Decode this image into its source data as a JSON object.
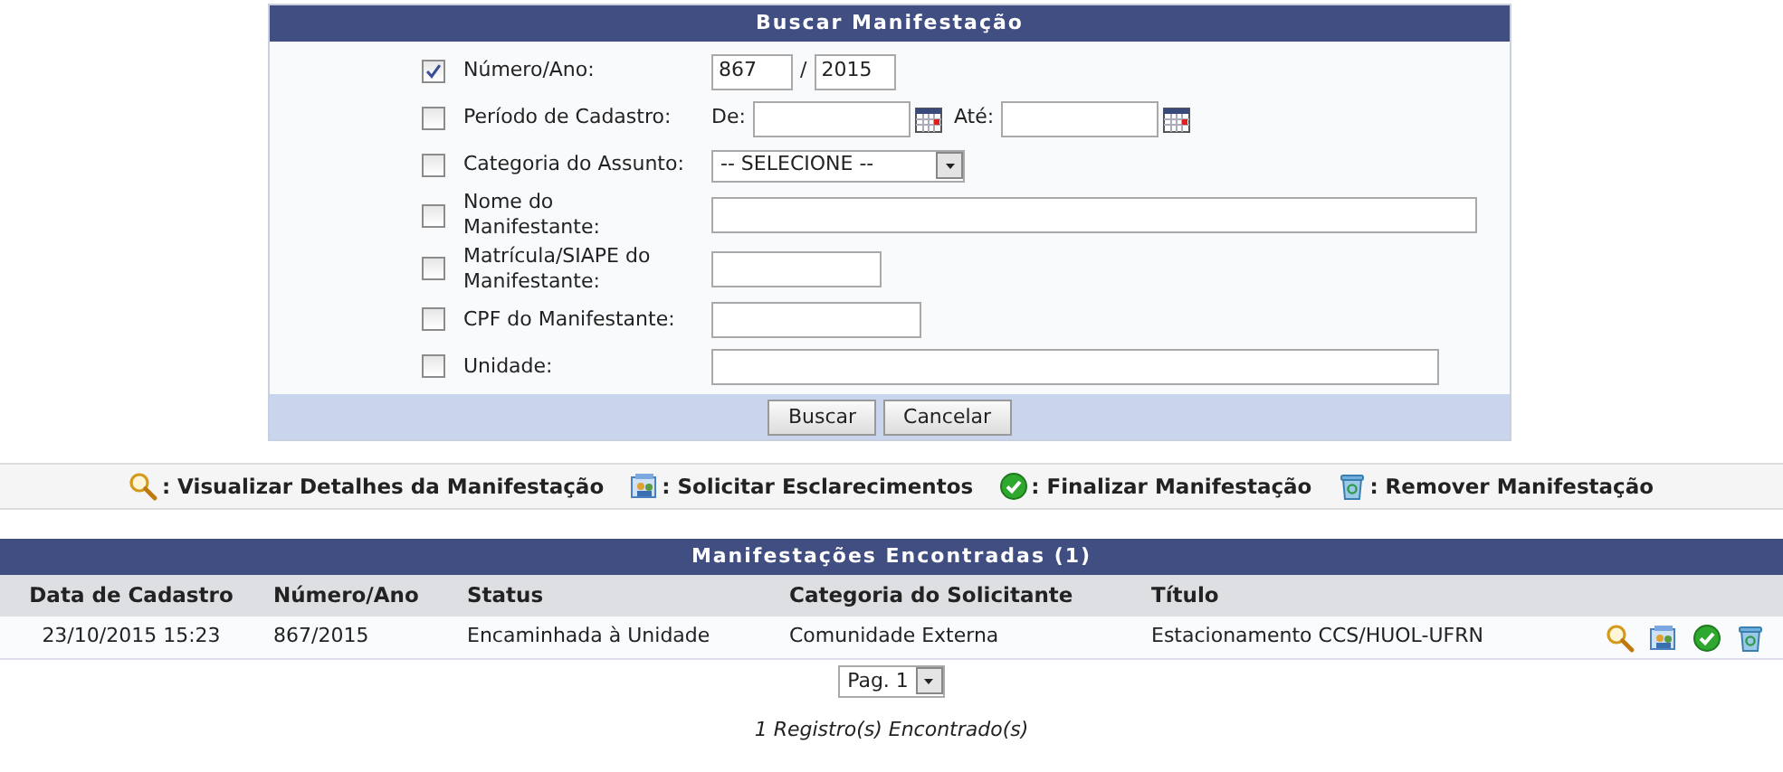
{
  "search_form": {
    "title": "Buscar Manifestação",
    "fields": [
      {
        "kind": "pair",
        "label": "Número/Ano:",
        "checked": true,
        "values": [
          "867",
          "2015"
        ],
        "separator": "/"
      },
      {
        "kind": "range",
        "label": "Período de Cadastro:",
        "checked": false,
        "from_label": "De:",
        "to_label": "Até:"
      },
      {
        "kind": "select",
        "label": "Categoria do Assunto:",
        "checked": false,
        "value": "-- SELECIONE --"
      },
      {
        "kind": "text",
        "label": "Nome do Manifestante:",
        "checked": false
      },
      {
        "kind": "text",
        "label": "Matrícula/SIAPE do Manifestante:",
        "checked": false
      },
      {
        "kind": "text",
        "label": "CPF do Manifestante:",
        "checked": false
      },
      {
        "kind": "text",
        "label": "Unidade:",
        "checked": false
      }
    ],
    "buttons": [
      "Buscar",
      "Cancelar"
    ]
  },
  "legend": [
    {
      "kind": "view",
      "text": ": Visualizar Detalhes da Manifestação"
    },
    {
      "kind": "clarify",
      "text": ": Solicitar Esclarecimentos"
    },
    {
      "kind": "finalize",
      "text": ": Finalizar Manifestação"
    },
    {
      "kind": "remove",
      "text": ": Remover Manifestação"
    }
  ],
  "results": {
    "title": "Manifestações Encontradas (1)",
    "columns": [
      "Data de Cadastro",
      "Número/Ano",
      "Status",
      "Categoria do Solicitante",
      "Título"
    ],
    "rows": [
      {
        "cells": [
          "23/10/2015 15:23",
          "867/2015",
          "Encaminhada à Unidade",
          "Comunidade Externa",
          "Estacionamento CCS/HUOL-UFRN"
        ],
        "actions": [
          {
            "kind": "view"
          },
          {
            "kind": "clarify"
          },
          {
            "kind": "finalize"
          },
          {
            "kind": "remove"
          }
        ]
      }
    ],
    "pagination": "Pag. 1",
    "footer": "1 Registro(s) Encontrado(s)"
  }
}
